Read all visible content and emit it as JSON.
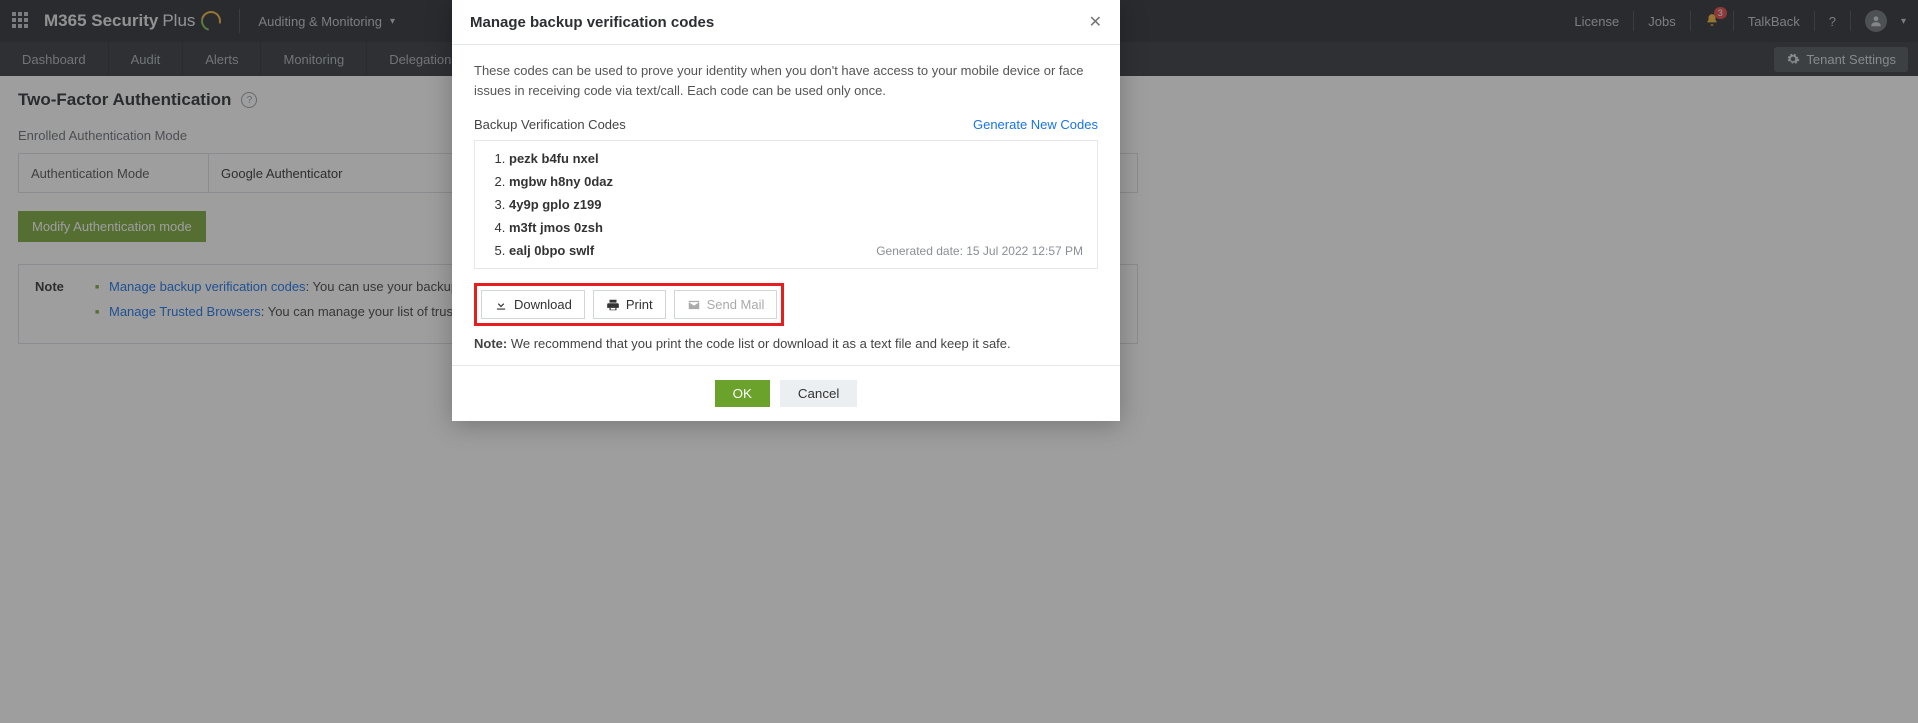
{
  "brand": {
    "name": "M365 Security",
    "suffix": "Plus"
  },
  "module_selector": "Auditing & Monitoring",
  "top_links": {
    "license": "License",
    "jobs": "Jobs",
    "talkback": "TalkBack",
    "notif_count": "3"
  },
  "nav_tabs": [
    "Dashboard",
    "Audit",
    "Alerts",
    "Monitoring",
    "Delegation"
  ],
  "tenant_button": "Tenant Settings",
  "page": {
    "title": "Two-Factor Authentication",
    "enrolled_label": "Enrolled Authentication Mode",
    "mode_label": "Authentication Mode",
    "mode_value": "Google Authenticator",
    "modify_btn": "Modify Authentication mode",
    "note_label": "Note",
    "notes": [
      {
        "link": "Manage backup verification codes",
        "rest": ": You can use your backup verification codes to prove your identity when you don't have access to other authentication methods."
      },
      {
        "link": "Manage Trusted Browsers",
        "rest": ": You can manage your list of trusted browsers."
      }
    ]
  },
  "modal": {
    "title": "Manage backup verification codes",
    "description": "These codes can be used to prove your identity when you don't have access to your mobile device or face issues in receiving code via text/call. Each code can be used only once.",
    "codes_label": "Backup Verification Codes",
    "generate_link": "Generate New Codes",
    "codes": [
      "pezk b4fu nxel",
      "mgbw h8ny 0daz",
      "4y9p gplo z199",
      "m3ft jmos 0zsh",
      "ealj 0bpo swlf"
    ],
    "generated_date": "Generated date: 15 Jul 2022 12:57 PM",
    "download_btn": "Download",
    "print_btn": "Print",
    "sendmail_btn": "Send Mail",
    "note_prefix": "Note:",
    "note_text": " We recommend that you print the code list or download it as a text file and keep it safe.",
    "ok": "OK",
    "cancel": "Cancel"
  }
}
